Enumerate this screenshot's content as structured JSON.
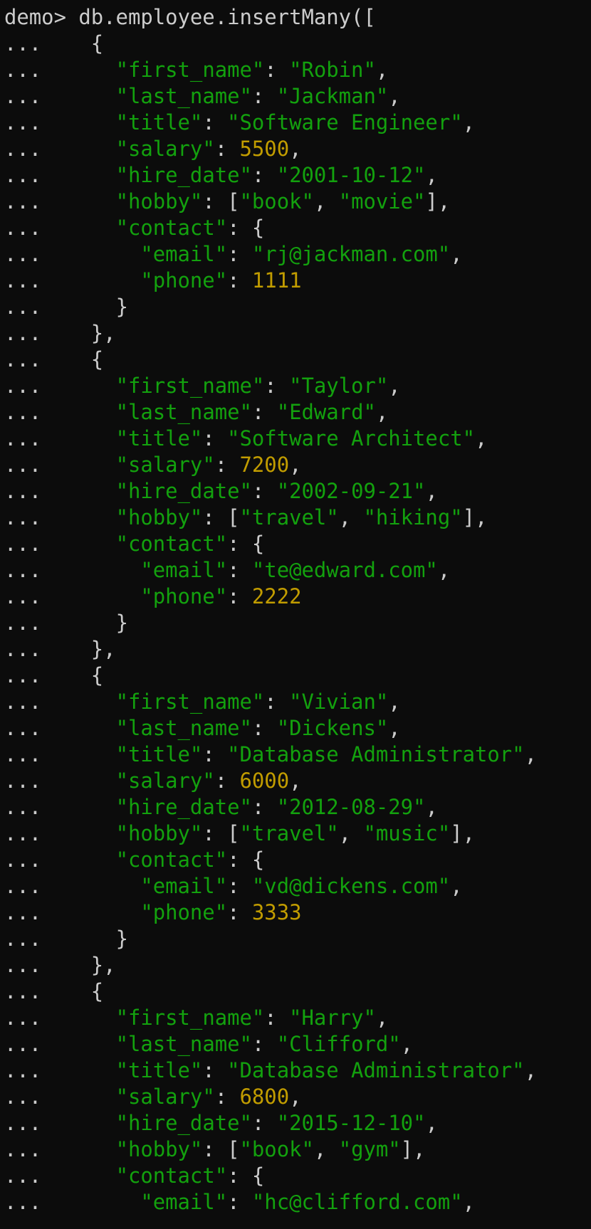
{
  "terminal": {
    "prompt": "demo> ",
    "command": "db.employee.insertMany([",
    "continuation": "...",
    "colors": {
      "background": "#0c0c0c",
      "default_text": "#cccccc",
      "string": "#13a10e",
      "number": "#c19c00"
    }
  },
  "lines": [
    {
      "i": 0,
      "t": [
        [
          "p",
          "{"
        ]
      ]
    },
    {
      "i": 1,
      "t": [
        [
          "s",
          "\"first_name\""
        ],
        [
          "p",
          ": "
        ],
        [
          "s",
          "\"Robin\""
        ],
        [
          "p",
          ","
        ]
      ]
    },
    {
      "i": 1,
      "t": [
        [
          "s",
          "\"last_name\""
        ],
        [
          "p",
          ": "
        ],
        [
          "s",
          "\"Jackman\""
        ],
        [
          "p",
          ","
        ]
      ]
    },
    {
      "i": 1,
      "t": [
        [
          "s",
          "\"title\""
        ],
        [
          "p",
          ": "
        ],
        [
          "s",
          "\"Software Engineer\""
        ],
        [
          "p",
          ","
        ]
      ]
    },
    {
      "i": 1,
      "t": [
        [
          "s",
          "\"salary\""
        ],
        [
          "p",
          ": "
        ],
        [
          "n",
          "5500"
        ],
        [
          "p",
          ","
        ]
      ]
    },
    {
      "i": 1,
      "t": [
        [
          "s",
          "\"hire_date\""
        ],
        [
          "p",
          ": "
        ],
        [
          "s",
          "\"2001-10-12\""
        ],
        [
          "p",
          ","
        ]
      ]
    },
    {
      "i": 1,
      "t": [
        [
          "s",
          "\"hobby\""
        ],
        [
          "p",
          ": ["
        ],
        [
          "s",
          "\"book\""
        ],
        [
          "p",
          ", "
        ],
        [
          "s",
          "\"movie\""
        ],
        [
          "p",
          "],"
        ]
      ]
    },
    {
      "i": 1,
      "t": [
        [
          "s",
          "\"contact\""
        ],
        [
          "p",
          ": {"
        ]
      ]
    },
    {
      "i": 2,
      "t": [
        [
          "s",
          "\"email\""
        ],
        [
          "p",
          ": "
        ],
        [
          "s",
          "\"rj@jackman.com\""
        ],
        [
          "p",
          ","
        ]
      ]
    },
    {
      "i": 2,
      "t": [
        [
          "s",
          "\"phone\""
        ],
        [
          "p",
          ": "
        ],
        [
          "n",
          "1111"
        ]
      ]
    },
    {
      "i": 1,
      "t": [
        [
          "p",
          "}"
        ]
      ]
    },
    {
      "i": 0,
      "t": [
        [
          "p",
          "},"
        ]
      ]
    },
    {
      "i": 0,
      "t": [
        [
          "p",
          "{"
        ]
      ]
    },
    {
      "i": 1,
      "t": [
        [
          "s",
          "\"first_name\""
        ],
        [
          "p",
          ": "
        ],
        [
          "s",
          "\"Taylor\""
        ],
        [
          "p",
          ","
        ]
      ]
    },
    {
      "i": 1,
      "t": [
        [
          "s",
          "\"last_name\""
        ],
        [
          "p",
          ": "
        ],
        [
          "s",
          "\"Edward\""
        ],
        [
          "p",
          ","
        ]
      ]
    },
    {
      "i": 1,
      "t": [
        [
          "s",
          "\"title\""
        ],
        [
          "p",
          ": "
        ],
        [
          "s",
          "\"Software Architect\""
        ],
        [
          "p",
          ","
        ]
      ]
    },
    {
      "i": 1,
      "t": [
        [
          "s",
          "\"salary\""
        ],
        [
          "p",
          ": "
        ],
        [
          "n",
          "7200"
        ],
        [
          "p",
          ","
        ]
      ]
    },
    {
      "i": 1,
      "t": [
        [
          "s",
          "\"hire_date\""
        ],
        [
          "p",
          ": "
        ],
        [
          "s",
          "\"2002-09-21\""
        ],
        [
          "p",
          ","
        ]
      ]
    },
    {
      "i": 1,
      "t": [
        [
          "s",
          "\"hobby\""
        ],
        [
          "p",
          ": ["
        ],
        [
          "s",
          "\"travel\""
        ],
        [
          "p",
          ", "
        ],
        [
          "s",
          "\"hiking\""
        ],
        [
          "p",
          "],"
        ]
      ]
    },
    {
      "i": 1,
      "t": [
        [
          "s",
          "\"contact\""
        ],
        [
          "p",
          ": {"
        ]
      ]
    },
    {
      "i": 2,
      "t": [
        [
          "s",
          "\"email\""
        ],
        [
          "p",
          ": "
        ],
        [
          "s",
          "\"te@edward.com\""
        ],
        [
          "p",
          ","
        ]
      ]
    },
    {
      "i": 2,
      "t": [
        [
          "s",
          "\"phone\""
        ],
        [
          "p",
          ": "
        ],
        [
          "n",
          "2222"
        ]
      ]
    },
    {
      "i": 1,
      "t": [
        [
          "p",
          "}"
        ]
      ]
    },
    {
      "i": 0,
      "t": [
        [
          "p",
          "},"
        ]
      ]
    },
    {
      "i": 0,
      "t": [
        [
          "p",
          "{"
        ]
      ]
    },
    {
      "i": 1,
      "t": [
        [
          "s",
          "\"first_name\""
        ],
        [
          "p",
          ": "
        ],
        [
          "s",
          "\"Vivian\""
        ],
        [
          "p",
          ","
        ]
      ]
    },
    {
      "i": 1,
      "t": [
        [
          "s",
          "\"last_name\""
        ],
        [
          "p",
          ": "
        ],
        [
          "s",
          "\"Dickens\""
        ],
        [
          "p",
          ","
        ]
      ]
    },
    {
      "i": 1,
      "t": [
        [
          "s",
          "\"title\""
        ],
        [
          "p",
          ": "
        ],
        [
          "s",
          "\"Database Administrator\""
        ],
        [
          "p",
          ","
        ]
      ]
    },
    {
      "i": 1,
      "t": [
        [
          "s",
          "\"salary\""
        ],
        [
          "p",
          ": "
        ],
        [
          "n",
          "6000"
        ],
        [
          "p",
          ","
        ]
      ]
    },
    {
      "i": 1,
      "t": [
        [
          "s",
          "\"hire_date\""
        ],
        [
          "p",
          ": "
        ],
        [
          "s",
          "\"2012-08-29\""
        ],
        [
          "p",
          ","
        ]
      ]
    },
    {
      "i": 1,
      "t": [
        [
          "s",
          "\"hobby\""
        ],
        [
          "p",
          ": ["
        ],
        [
          "s",
          "\"travel\""
        ],
        [
          "p",
          ", "
        ],
        [
          "s",
          "\"music\""
        ],
        [
          "p",
          "],"
        ]
      ]
    },
    {
      "i": 1,
      "t": [
        [
          "s",
          "\"contact\""
        ],
        [
          "p",
          ": {"
        ]
      ]
    },
    {
      "i": 2,
      "t": [
        [
          "s",
          "\"email\""
        ],
        [
          "p",
          ": "
        ],
        [
          "s",
          "\"vd@dickens.com\""
        ],
        [
          "p",
          ","
        ]
      ]
    },
    {
      "i": 2,
      "t": [
        [
          "s",
          "\"phone\""
        ],
        [
          "p",
          ": "
        ],
        [
          "n",
          "3333"
        ]
      ]
    },
    {
      "i": 1,
      "t": [
        [
          "p",
          "}"
        ]
      ]
    },
    {
      "i": 0,
      "t": [
        [
          "p",
          "},"
        ]
      ]
    },
    {
      "i": 0,
      "t": [
        [
          "p",
          "{"
        ]
      ]
    },
    {
      "i": 1,
      "t": [
        [
          "s",
          "\"first_name\""
        ],
        [
          "p",
          ": "
        ],
        [
          "s",
          "\"Harry\""
        ],
        [
          "p",
          ","
        ]
      ]
    },
    {
      "i": 1,
      "t": [
        [
          "s",
          "\"last_name\""
        ],
        [
          "p",
          ": "
        ],
        [
          "s",
          "\"Clifford\""
        ],
        [
          "p",
          ","
        ]
      ]
    },
    {
      "i": 1,
      "t": [
        [
          "s",
          "\"title\""
        ],
        [
          "p",
          ": "
        ],
        [
          "s",
          "\"Database Administrator\""
        ],
        [
          "p",
          ","
        ]
      ]
    },
    {
      "i": 1,
      "t": [
        [
          "s",
          "\"salary\""
        ],
        [
          "p",
          ": "
        ],
        [
          "n",
          "6800"
        ],
        [
          "p",
          ","
        ]
      ]
    },
    {
      "i": 1,
      "t": [
        [
          "s",
          "\"hire_date\""
        ],
        [
          "p",
          ": "
        ],
        [
          "s",
          "\"2015-12-10\""
        ],
        [
          "p",
          ","
        ]
      ]
    },
    {
      "i": 1,
      "t": [
        [
          "s",
          "\"hobby\""
        ],
        [
          "p",
          ": ["
        ],
        [
          "s",
          "\"book\""
        ],
        [
          "p",
          ", "
        ],
        [
          "s",
          "\"gym\""
        ],
        [
          "p",
          "],"
        ]
      ]
    },
    {
      "i": 1,
      "t": [
        [
          "s",
          "\"contact\""
        ],
        [
          "p",
          ": {"
        ]
      ]
    },
    {
      "i": 2,
      "t": [
        [
          "s",
          "\"email\""
        ],
        [
          "p",
          ": "
        ],
        [
          "s",
          "\"hc@clifford.com\""
        ],
        [
          "p",
          ","
        ]
      ]
    }
  ]
}
